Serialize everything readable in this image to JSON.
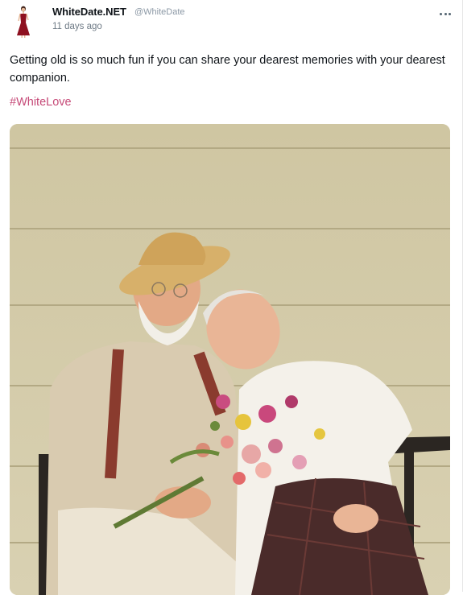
{
  "author": {
    "name": "WhiteDate.NET",
    "handle": "@WhiteDate",
    "time": "11 days ago",
    "avatar_icon": "woman-red-dress-avatar"
  },
  "tweet": {
    "text": "Getting old is so much fun if you can share your dearest memories with your dearest companion.",
    "hashtag": "#WhiteLove"
  },
  "photo": {
    "description_icon": "elderly-couple-photo"
  },
  "colors": {
    "hashtag": "#c64a78",
    "text": "#0f1419",
    "meta": "#8b98a5"
  }
}
